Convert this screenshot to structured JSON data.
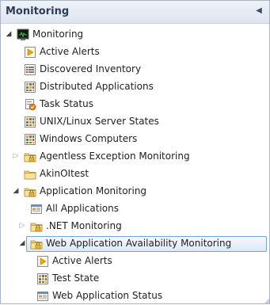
{
  "pane": {
    "title": "Monitoring"
  },
  "tree": {
    "items": [
      {
        "label": "Monitoring",
        "icon": "monitor-icon"
      },
      {
        "label": "Active Alerts",
        "icon": "alert-icon"
      },
      {
        "label": "Discovered Inventory",
        "icon": "inventory-icon"
      },
      {
        "label": "Distributed Applications",
        "icon": "state-grid-icon"
      },
      {
        "label": "Task Status",
        "icon": "task-status-icon"
      },
      {
        "label": "UNIX/Linux Server States",
        "icon": "state-grid-icon"
      },
      {
        "label": "Windows Computers",
        "icon": "state-grid-icon"
      },
      {
        "label": "Agentless Exception Monitoring",
        "icon": "folder-lock-icon",
        "expander": "closed"
      },
      {
        "label": "AkinOItest",
        "icon": "folder-icon"
      },
      {
        "label": "Application Monitoring",
        "icon": "folder-lock-icon",
        "expander": "open"
      },
      {
        "label": "All Applications",
        "icon": "app-view-icon"
      },
      {
        "label": ".NET Monitoring",
        "icon": "folder-lock-icon",
        "expander": "closed"
      },
      {
        "label": "Web Application Availability Monitoring",
        "icon": "folder-lock-icon",
        "expander": "open",
        "selected": true
      },
      {
        "label": "Active Alerts",
        "icon": "alert-icon"
      },
      {
        "label": "Test State",
        "icon": "state-grid-icon"
      },
      {
        "label": "Web Application Status",
        "icon": "app-view-icon"
      }
    ]
  },
  "colors": {
    "selection_border": "#7da2ce",
    "selection_fill": "#dce9f7",
    "header_text": "#2c3e57"
  }
}
